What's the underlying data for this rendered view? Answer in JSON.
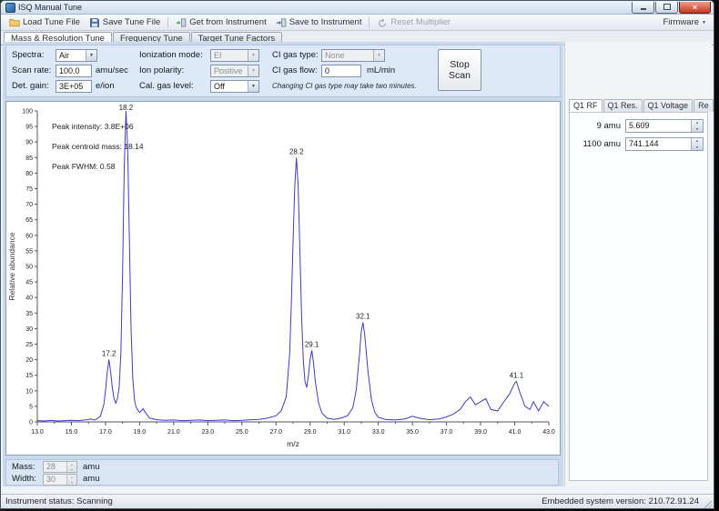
{
  "window": {
    "title": "ISQ Manual Tune"
  },
  "icons": {
    "dropdown_arrow": "▼",
    "spin_up": "▴",
    "spin_down": "▾",
    "tab_scroll_left": "◄",
    "tab_scroll_right": "►",
    "close_glyph": "×"
  },
  "toolbar": {
    "items": [
      {
        "label": "Load Tune File",
        "icon": "open-folder-icon",
        "enabled": true
      },
      {
        "label": "Save Tune File",
        "icon": "save-disk-icon",
        "enabled": true
      },
      {
        "label": "Get from Instrument",
        "icon": "get-from-instrument-icon",
        "enabled": true
      },
      {
        "label": "Save to Instrument",
        "icon": "save-to-instrument-icon",
        "enabled": true
      },
      {
        "label": "Reset Multiplier",
        "icon": "reset-multiplier-icon",
        "enabled": false
      }
    ],
    "firmware_label": "Firmware"
  },
  "tabs": [
    {
      "label": "Mass & Resolution Tune",
      "active": true
    },
    {
      "label": "Frequency Tune",
      "active": false
    },
    {
      "label": "Target Tune Factors",
      "active": false
    }
  ],
  "controls": {
    "spectra_label": "Spectra:",
    "spectra_value": "Air",
    "scan_rate_label": "Scan rate:",
    "scan_rate_value": "100.0",
    "scan_rate_unit": "amu/sec",
    "det_gain_label": "Det. gain:",
    "det_gain_value": "3E+05",
    "det_gain_unit": "e/ion",
    "ionization_mode_label": "Ionization mode:",
    "ionization_mode_value": "EI",
    "ion_polarity_label": "Ion polarity:",
    "ion_polarity_value": "Positive",
    "cal_gas_label": "Cal. gas level:",
    "cal_gas_value": "Off",
    "ci_gas_type_label": "CI gas type:",
    "ci_gas_type_value": "None",
    "ci_gas_flow_label": "CI gas flow:",
    "ci_gas_flow_value": "0",
    "ci_gas_flow_unit": "mL/min",
    "ci_note": "Changing CI gas type may take two minutes.",
    "stop_button_label": "Stop Scan"
  },
  "chart_data": {
    "type": "line",
    "xlabel": "m/z",
    "ylabel": "Relative abundance",
    "xlim": [
      13,
      43
    ],
    "ylim": [
      0,
      100
    ],
    "x_tick_step": 2,
    "x_minor_step": 1,
    "y_tick_step": 5,
    "grid": false,
    "legend": "none",
    "line_color": "#3c3ccd",
    "annotations": [
      "Peak intensity: 3.8E+06",
      "Peak centroid mass: 18.14",
      "Peak FWHM: 0.58"
    ],
    "peaks": [
      {
        "mz": 17.2,
        "abundance": 20,
        "label": "17.2"
      },
      {
        "mz": 18.2,
        "abundance": 100,
        "label": "18.2"
      },
      {
        "mz": 28.2,
        "abundance": 85,
        "label": "28.2"
      },
      {
        "mz": 29.1,
        "abundance": 23,
        "label": "29.1"
      },
      {
        "mz": 32.1,
        "abundance": 32,
        "label": "32.1"
      },
      {
        "mz": 41.1,
        "abundance": 13,
        "label": "41.1"
      }
    ],
    "trace": [
      [
        13.0,
        0.4
      ],
      [
        13.4,
        0.3
      ],
      [
        13.8,
        0.5
      ],
      [
        14.2,
        0.3
      ],
      [
        14.6,
        0.4
      ],
      [
        15.0,
        0.5
      ],
      [
        15.4,
        0.4
      ],
      [
        15.8,
        0.6
      ],
      [
        16.1,
        0.9
      ],
      [
        16.4,
        0.6
      ],
      [
        16.7,
        1.8
      ],
      [
        16.9,
        5.5
      ],
      [
        17.0,
        10
      ],
      [
        17.1,
        16
      ],
      [
        17.2,
        20
      ],
      [
        17.3,
        16
      ],
      [
        17.4,
        11
      ],
      [
        17.5,
        7.5
      ],
      [
        17.6,
        6
      ],
      [
        17.7,
        7.5
      ],
      [
        17.8,
        11
      ],
      [
        17.9,
        22
      ],
      [
        18.0,
        48
      ],
      [
        18.1,
        82
      ],
      [
        18.2,
        100
      ],
      [
        18.3,
        88
      ],
      [
        18.4,
        58
      ],
      [
        18.5,
        30
      ],
      [
        18.6,
        14
      ],
      [
        18.7,
        7
      ],
      [
        18.8,
        4.5
      ],
      [
        19.0,
        3
      ],
      [
        19.2,
        4.2
      ],
      [
        19.4,
        2.5
      ],
      [
        19.6,
        1.2
      ],
      [
        20.0,
        0.7
      ],
      [
        20.5,
        0.5
      ],
      [
        21.0,
        0.6
      ],
      [
        21.5,
        0.4
      ],
      [
        22.0,
        0.5
      ],
      [
        22.5,
        0.6
      ],
      [
        23.0,
        0.4
      ],
      [
        23.5,
        0.5
      ],
      [
        24.0,
        0.6
      ],
      [
        24.5,
        0.4
      ],
      [
        25.0,
        0.5
      ],
      [
        25.5,
        0.7
      ],
      [
        26.0,
        0.8
      ],
      [
        26.5,
        1.2
      ],
      [
        27.0,
        2.0
      ],
      [
        27.3,
        3.5
      ],
      [
        27.6,
        8
      ],
      [
        27.8,
        22
      ],
      [
        27.9,
        38
      ],
      [
        28.0,
        58
      ],
      [
        28.1,
        76
      ],
      [
        28.2,
        85
      ],
      [
        28.3,
        76
      ],
      [
        28.4,
        55
      ],
      [
        28.5,
        34
      ],
      [
        28.6,
        20
      ],
      [
        28.7,
        13
      ],
      [
        28.8,
        11
      ],
      [
        28.9,
        15
      ],
      [
        29.0,
        20
      ],
      [
        29.1,
        23
      ],
      [
        29.2,
        19
      ],
      [
        29.3,
        13
      ],
      [
        29.5,
        6
      ],
      [
        29.7,
        2.8
      ],
      [
        30.0,
        1.2
      ],
      [
        30.4,
        0.8
      ],
      [
        30.8,
        1.2
      ],
      [
        31.2,
        2
      ],
      [
        31.5,
        4.5
      ],
      [
        31.7,
        10
      ],
      [
        31.9,
        22
      ],
      [
        32.0,
        29
      ],
      [
        32.1,
        32
      ],
      [
        32.2,
        28
      ],
      [
        32.4,
        16
      ],
      [
        32.6,
        7
      ],
      [
        32.8,
        3
      ],
      [
        33.0,
        1.5
      ],
      [
        33.4,
        0.8
      ],
      [
        34.0,
        0.6
      ],
      [
        34.6,
        1.0
      ],
      [
        35.0,
        1.8
      ],
      [
        35.4,
        1.2
      ],
      [
        36.0,
        0.7
      ],
      [
        36.6,
        1.0
      ],
      [
        37.0,
        1.6
      ],
      [
        37.4,
        2.5
      ],
      [
        37.8,
        4
      ],
      [
        38.1,
        6.5
      ],
      [
        38.4,
        8
      ],
      [
        38.7,
        5.5
      ],
      [
        39.0,
        6.5
      ],
      [
        39.3,
        7.5
      ],
      [
        39.6,
        4
      ],
      [
        40.0,
        3.5
      ],
      [
        40.3,
        6
      ],
      [
        40.7,
        9
      ],
      [
        41.0,
        12.5
      ],
      [
        41.1,
        13
      ],
      [
        41.3,
        9.5
      ],
      [
        41.6,
        5
      ],
      [
        41.9,
        4
      ],
      [
        42.1,
        6.5
      ],
      [
        42.4,
        3.5
      ],
      [
        42.7,
        6.5
      ],
      [
        43.0,
        5
      ]
    ]
  },
  "bottom_bar": {
    "mass_label": "Mass:",
    "mass_value": "28",
    "mass_unit": "amu",
    "width_label": "Width:",
    "width_value": "30",
    "width_unit": "amu"
  },
  "right_panel": {
    "tabs": [
      {
        "label": "Q1 RF",
        "active": true
      },
      {
        "label": "Q1 Res.",
        "active": false
      },
      {
        "label": "Q1 Voltage",
        "active": false
      },
      {
        "label": "Re",
        "active": false
      }
    ],
    "fields": [
      {
        "label": "9 amu",
        "value": "5.609"
      },
      {
        "label": "1100 amu",
        "value": "741.144"
      }
    ]
  },
  "status_bar": {
    "left": "Instrument status: Scanning",
    "right": "Embedded system version: 210.72.91.24"
  }
}
